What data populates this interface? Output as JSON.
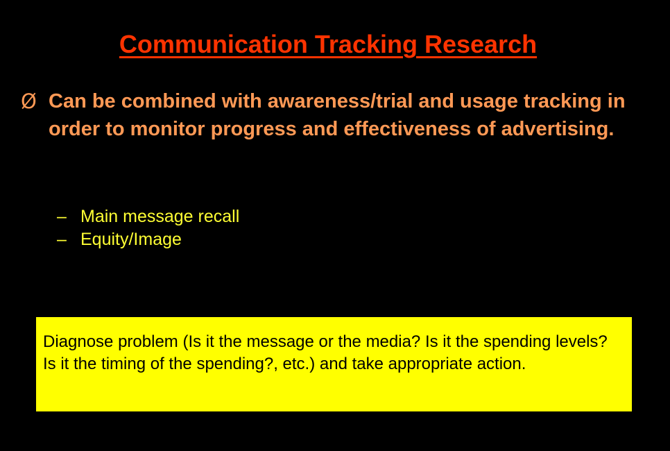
{
  "slide": {
    "title": "Communication Tracking Research",
    "main_bullet": {
      "icon": "arrow-bullet-icon",
      "glyph": "Ø",
      "text": "Can be combined with awareness/trial and usage tracking in order to monitor progress and effectiveness of advertising."
    },
    "sub_bullets": [
      {
        "dash": "–",
        "text": "Main message recall"
      },
      {
        "dash": "–",
        "text": "Equity/Image"
      }
    ],
    "callout": {
      "text": "Diagnose problem (Is it the message or the media?  Is it the spending levels? Is it the timing of the spending?, etc.) and take appropriate action."
    }
  },
  "colors": {
    "background": "#000000",
    "title": "#ff3300",
    "main_bullet": "#ff9955",
    "sub_bullets": "#ffff33",
    "callout_bg": "#ffff00",
    "callout_text": "#000000"
  }
}
